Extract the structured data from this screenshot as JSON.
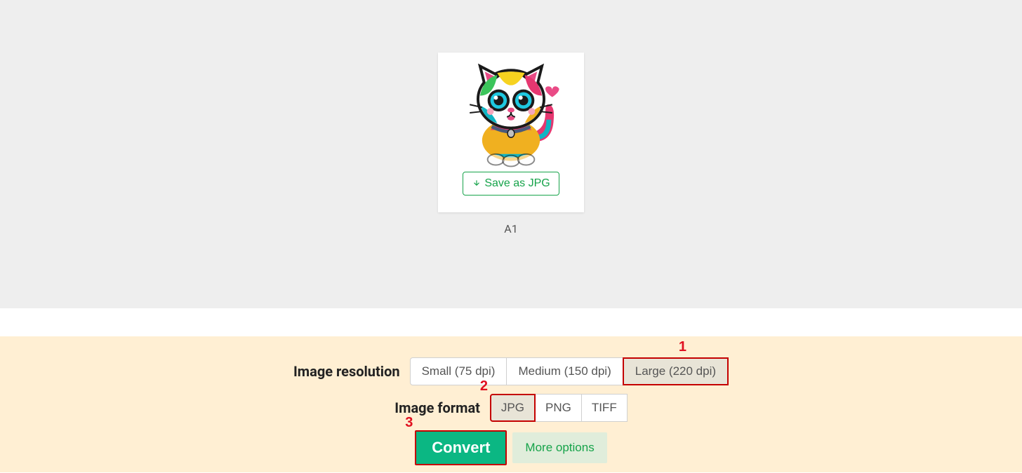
{
  "preview": {
    "save_label": "Save as JPG",
    "image_label": "A1"
  },
  "options": {
    "resolution_label": "Image resolution",
    "resolutions": {
      "small": "Small (75 dpi)",
      "medium": "Medium (150 dpi)",
      "large": "Large (220 dpi)"
    },
    "format_label": "Image format",
    "formats": {
      "jpg": "JPG",
      "png": "PNG",
      "tiff": "TIFF"
    }
  },
  "actions": {
    "convert": "Convert",
    "more_options": "More options"
  },
  "annotations": {
    "a1": "1",
    "a2": "2",
    "a3": "3"
  }
}
